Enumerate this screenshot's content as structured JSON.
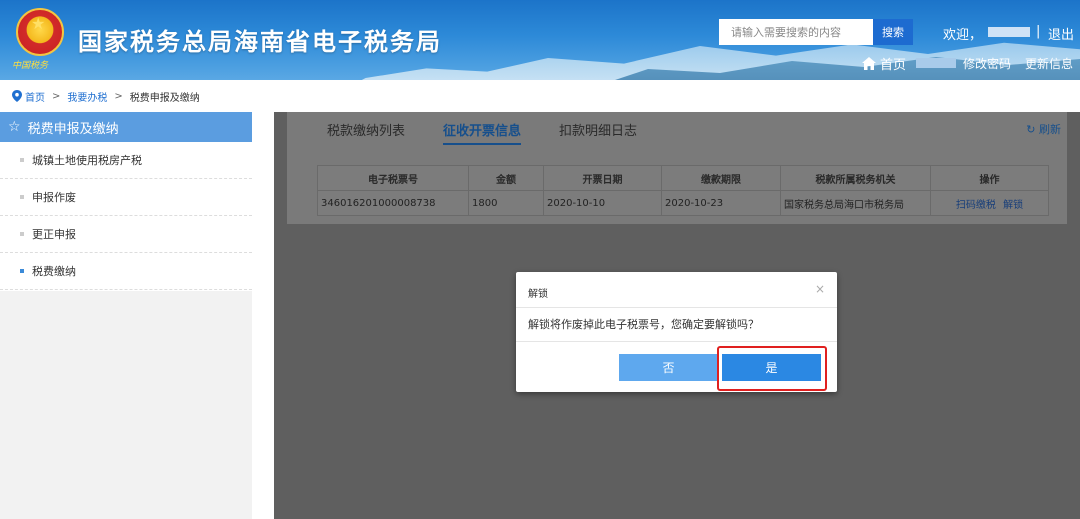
{
  "header": {
    "emblem_text": "中国税务",
    "title": "国家税务总局海南省电子税务局",
    "search": {
      "placeholder": "请输入需要搜索的内容",
      "button": "搜索"
    },
    "welcome": "欢迎，",
    "separator": "|",
    "logout": "退出",
    "home": "首页",
    "change_password": "修改密码",
    "update_info": "更新信息"
  },
  "breadcrumb": {
    "items": [
      "首页",
      "我要办税",
      "税费申报及缴纳"
    ],
    "separator": ">"
  },
  "sidebar": {
    "title": "税费申报及缴纳",
    "items": [
      {
        "label": "城镇土地使用税房产税"
      },
      {
        "label": "申报作废"
      },
      {
        "label": "更正申报"
      },
      {
        "label": "税费缴纳"
      }
    ]
  },
  "main": {
    "tabs": [
      {
        "label": "税款缴纳列表"
      },
      {
        "label": "征收开票信息"
      },
      {
        "label": "扣款明细日志"
      }
    ],
    "refresh": "刷新",
    "table": {
      "columns": [
        "电子税票号",
        "金额",
        "开票日期",
        "缴款期限",
        "税款所属税务机关",
        "操作"
      ],
      "rows": [
        {
          "ticket_no": "346016201000008738",
          "amount": "1800",
          "issue_date": "2020-10-10",
          "due_date": "2020-10-23",
          "authority": "国家税务总局海口市税务局",
          "actions": [
            "扫码缴税",
            "解锁"
          ]
        }
      ]
    }
  },
  "modal": {
    "title": "解锁",
    "close": "×",
    "message": "解锁将作废掉此电子税票号，您确定要解锁吗？",
    "cancel": "否",
    "confirm": "是"
  },
  "colors": {
    "header_blue": "#1c74c9",
    "sidebar_active": "#5b9de0",
    "confirm_button": "#2b88e3",
    "highlight": "#e0201f"
  }
}
